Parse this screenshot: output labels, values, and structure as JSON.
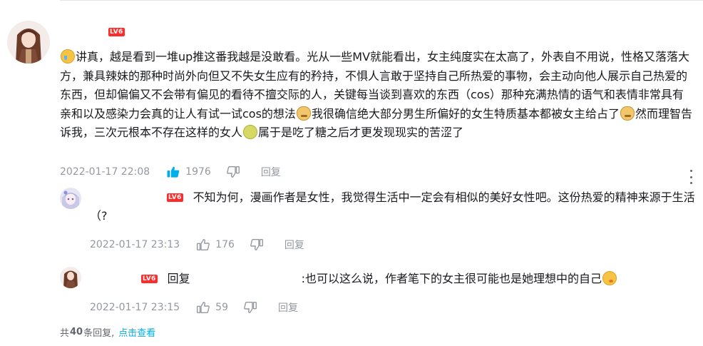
{
  "main_comment": {
    "level_badge": "LV6",
    "segments": [
      {
        "type": "emoji",
        "name": "crying-emoji"
      },
      {
        "type": "text",
        "value": "讲真，越是看到一堆up推这番我越是没敢看。光从一些MV就能看出，女主纯度实在太高了，外表自不用说，性格又落落大方，兼具辣妹的那种时尚外向但又不失女生应有的矜持，不惧人言敢于坚持自己所热爱的事物，会主动向他人展示自己热爱的东西，但却偏偏又不会带有偏见的看待不擅交际的人，关键每当谈到喜欢的东西（cos）那种充满热情的语气和表情非常具有亲和以及感染力会真的让人有试一试cos的想法"
      },
      {
        "type": "emoji",
        "name": "dog-emoji"
      },
      {
        "type": "text",
        "value": "我很确信绝大部分男生所偏好的女生特质基本都被女主给占了"
      },
      {
        "type": "emoji",
        "name": "dog-emoji"
      },
      {
        "type": "text",
        "value": "然而理智告诉我，三次元根本不存在这样的女人"
      },
      {
        "type": "emoji",
        "name": "green-emoji"
      },
      {
        "type": "text",
        "value": "属于是吃了糖之后才更发现现实的苦涩了"
      }
    ],
    "time": "2022-01-17 22:08",
    "likes": "1976",
    "reply_label": "回复"
  },
  "replies": [
    {
      "level_badge": "LV6",
      "text": "不知为何，漫画作者是女性，我觉得生活中一定会有相似的美好女性吧。这份热爱的精神来源于生活（?",
      "time": "2022-01-17 23:13",
      "likes": "176",
      "reply_label": "回复"
    },
    {
      "level_badge": "LV6",
      "reply_word": "回复",
      "text": ":也可以这么说，作者笔下的女主很可能也是她理想中的自己",
      "time": "2022-01-17 23:15",
      "likes": "59",
      "reply_label": "回复"
    }
  ],
  "footer": {
    "prefix": "共",
    "count": "40",
    "suffix": "条回复,",
    "view_link": "点击查看"
  },
  "colors": {
    "level_badge": "#ff2b2b",
    "like_active": "#00aeec",
    "meta_gray": "#9499a0",
    "link_blue": "#00aeec"
  }
}
